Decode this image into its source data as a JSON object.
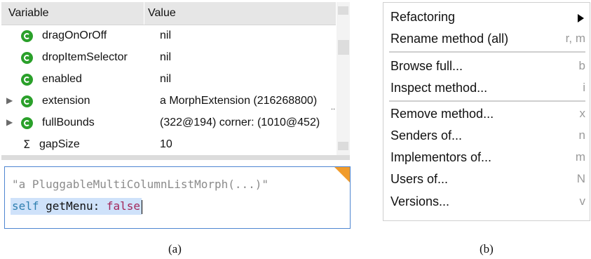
{
  "inspector": {
    "columns": {
      "variable": "Variable",
      "value": "Value"
    },
    "rows": [
      {
        "name": "dragOnOrOff",
        "value": "nil",
        "expandable": "",
        "icon": "green-variable-icon"
      },
      {
        "name": "dropItemSelector",
        "value": "nil",
        "expandable": "",
        "icon": "green-variable-icon"
      },
      {
        "name": "enabled",
        "value": "nil",
        "expandable": "",
        "icon": "green-variable-icon"
      },
      {
        "name": "extension",
        "value": "a MorphExtension (216268800)",
        "expandable": "▶",
        "icon": "green-variable-icon",
        "truncated": ".."
      },
      {
        "name": "fullBounds",
        "value": "(322@194) corner: (1010@452)",
        "expandable": "▶",
        "icon": "green-variable-icon"
      },
      {
        "name": "gapSize",
        "value": "10",
        "expandable": "",
        "icon": "sigma-icon",
        "icon_glyph": "Σ"
      }
    ],
    "code": {
      "line1": "\"a PluggableMultiColumnListMorph(...)\"",
      "line2_self": "self",
      "line2_msg": " getMenu: ",
      "line2_arg": "false"
    },
    "caption": "(a)"
  },
  "menu": {
    "items": [
      {
        "label": "Refactoring",
        "shortcut": "",
        "submenu": true
      },
      {
        "label": "Rename method (all)",
        "shortcut": "r, m"
      },
      {
        "label": "Browse full...",
        "shortcut": "b"
      },
      {
        "label": "Inspect method...",
        "shortcut": "i"
      },
      {
        "label": "Remove method...",
        "shortcut": "x"
      },
      {
        "label": "Senders of...",
        "shortcut": "n"
      },
      {
        "label": "Implementors of...",
        "shortcut": "m"
      },
      {
        "label": "Users of...",
        "shortcut": "N"
      },
      {
        "label": "Versions...",
        "shortcut": "v"
      }
    ],
    "caption": "(b)"
  },
  "colors": {
    "variable_icon": "#2aa02a",
    "selection": "#cfe2fa",
    "focus_border": "#4f86d1",
    "corner_marker": "#f19b2a",
    "keyword_self": "#2f7fb0",
    "keyword_false": "#a3265a"
  }
}
